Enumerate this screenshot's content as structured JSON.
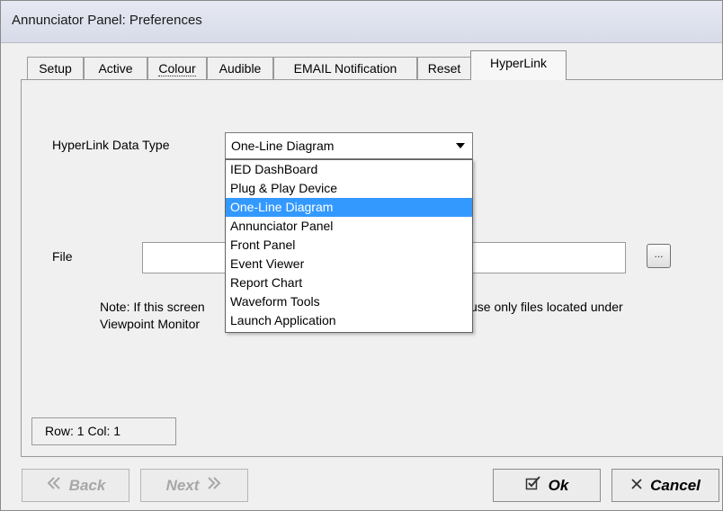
{
  "window": {
    "title": "Annunciator Panel: Preferences"
  },
  "tabs": [
    {
      "label": "Setup"
    },
    {
      "label": "Active"
    },
    {
      "label": "Colour"
    },
    {
      "label": "Audible"
    },
    {
      "label": "EMAIL Notification"
    },
    {
      "label": "Reset"
    },
    {
      "label": "HyperLink"
    }
  ],
  "active_tab": "HyperLink",
  "form": {
    "data_type_label": "HyperLink Data Type",
    "data_type_value": "One-Line Diagram",
    "file_label": "File",
    "file_value": "",
    "browse_label": "...",
    "note_line1": "Note: If this screen",
    "note_line1_tail": "use only files located under",
    "note_line2": "Viewpoint Monitor"
  },
  "dropdown": {
    "options": [
      "IED DashBoard",
      "Plug & Play Device",
      "One-Line Diagram",
      "Annunciator Panel",
      "Front Panel",
      "Event Viewer",
      "Report Chart",
      "Waveform Tools",
      "Launch Application"
    ],
    "selected": "One-Line Diagram"
  },
  "status": {
    "text": "Row: 1  Col: 1"
  },
  "buttons": {
    "back": "Back",
    "next": "Next",
    "ok": "Ok",
    "cancel": "Cancel"
  },
  "icons": {
    "back": "double-chevron-left-icon",
    "next": "double-chevron-right-icon",
    "ok": "checkbox-check-icon",
    "cancel": "x-icon"
  },
  "colors": {
    "selection": "#3399ff",
    "disabled_text": "#a7a7a7"
  }
}
